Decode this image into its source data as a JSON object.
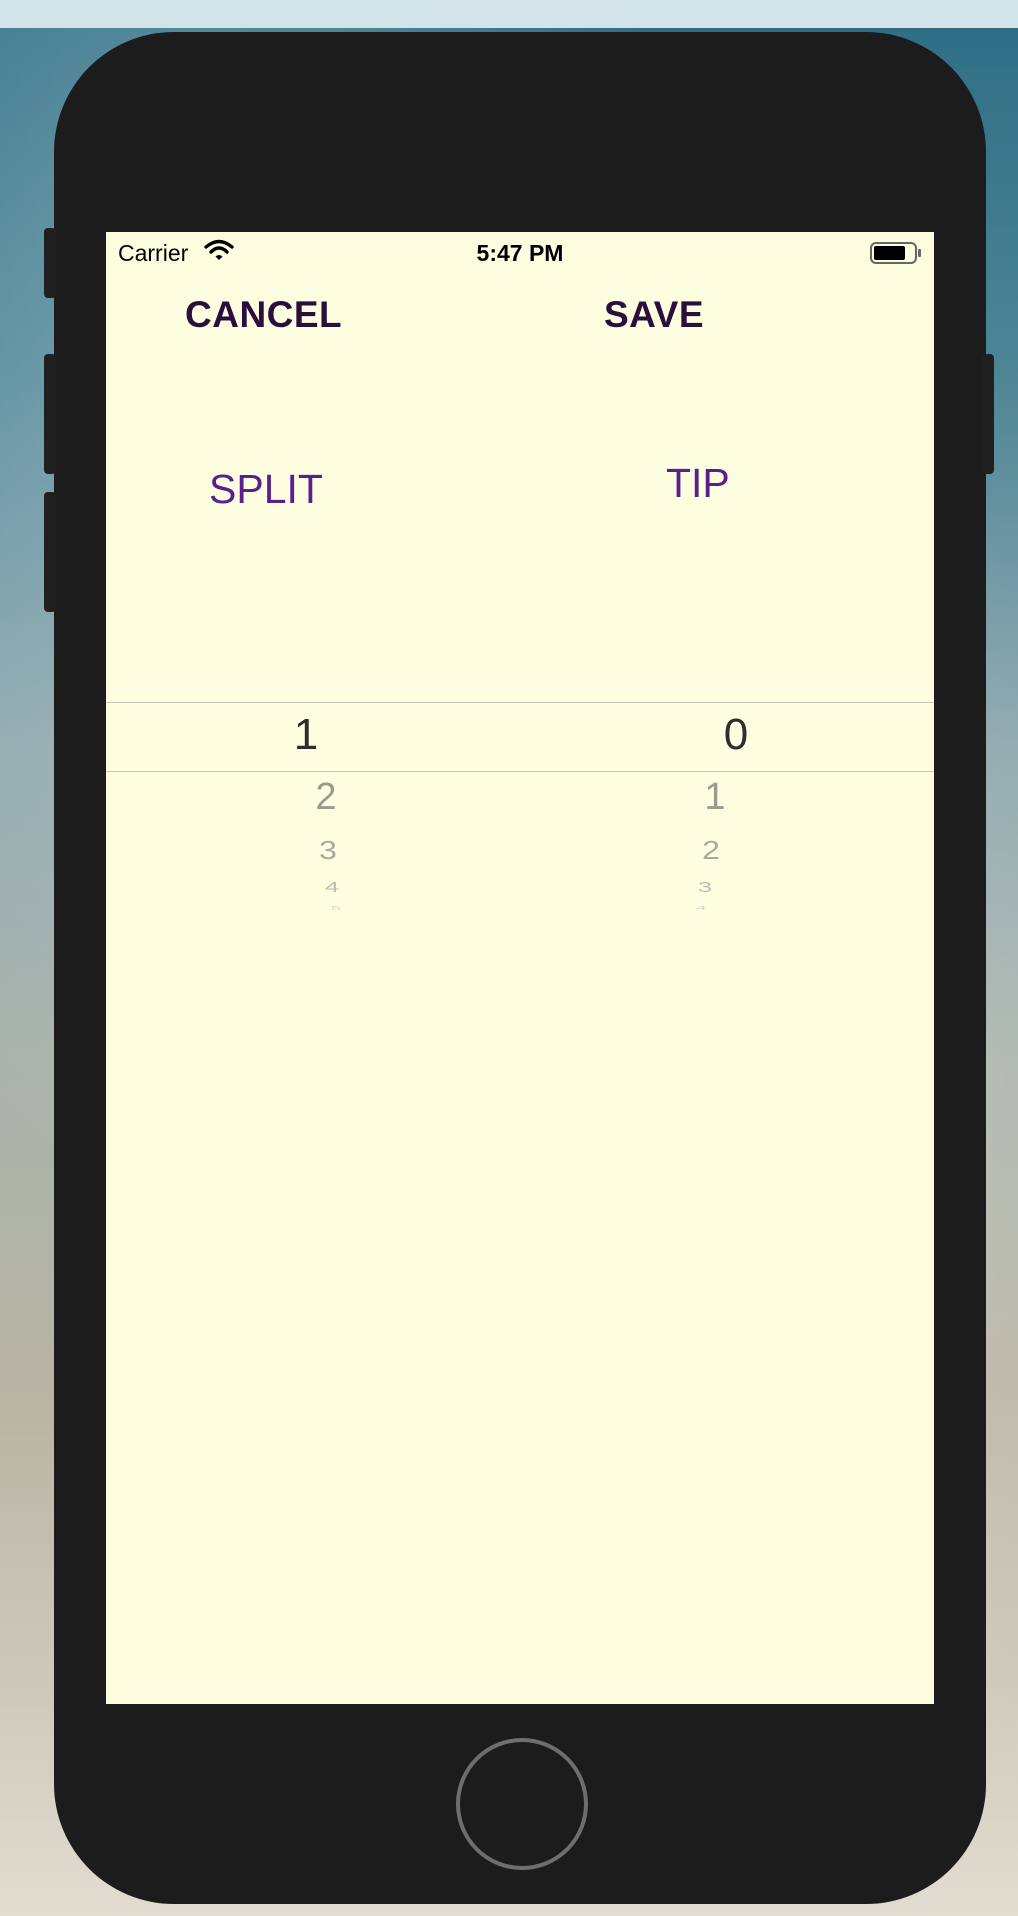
{
  "status_bar": {
    "carrier": "Carrier",
    "time": "5:47 PM",
    "icons": [
      "wifi-icon",
      "battery-icon"
    ]
  },
  "toolbar": {
    "cancel_label": "CANCEL",
    "save_label": "SAVE"
  },
  "sections": {
    "split_label": "SPLIT",
    "tip_label": "TIP"
  },
  "pickers": {
    "split": {
      "selected": "1",
      "below": [
        "2",
        "3",
        "4",
        "5"
      ]
    },
    "tip": {
      "selected": "0",
      "below": [
        "1",
        "2",
        "3",
        "4"
      ]
    }
  },
  "colors": {
    "screen_background": "#fdfde0",
    "toolbar_text": "#2c0e3d",
    "section_text": "#5b1f8c"
  }
}
